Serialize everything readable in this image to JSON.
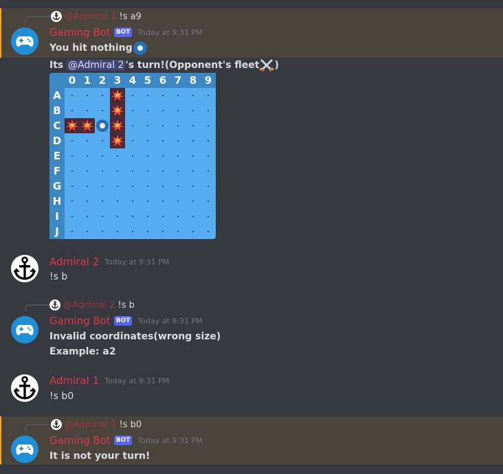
{
  "messages": [
    {
      "reply": {
        "mention": "@Admiral 1",
        "text": "!s a9"
      },
      "author": "Gaming Bot",
      "bot_tag": "BOT",
      "timestamp": "Today at 9:31 PM",
      "lines": [
        "You hit nothing"
      ],
      "follow_up": {
        "prefix": "Its ",
        "mention": "@Admiral 2",
        "suffix": "'s turn!(Opponent's fleet",
        "close": ")"
      }
    },
    {
      "author": "Admiral 2",
      "timestamp": "Today at 9:31 PM",
      "lines": [
        "!s b"
      ]
    },
    {
      "reply": {
        "mention": "@Admiral 2",
        "text": "!s b"
      },
      "author": "Gaming Bot",
      "bot_tag": "BOT",
      "timestamp": "Today at 9:31 PM",
      "lines": [
        "Invalid coordinates(wrong size)",
        "Example: a2"
      ]
    },
    {
      "author": "Admiral 1",
      "timestamp": "Today at 9:31 PM",
      "lines": [
        "!s b0"
      ]
    },
    {
      "reply": {
        "mention": "@Admiral 1",
        "text": "!s b0"
      },
      "author": "Gaming Bot",
      "bot_tag": "BOT",
      "timestamp": "Today at 9:31 PM",
      "lines": [
        "It is not your turn!"
      ]
    }
  ],
  "board": {
    "cols": [
      "0",
      "1",
      "2",
      "3",
      "4",
      "5",
      "6",
      "7",
      "8",
      "9"
    ],
    "rows": [
      "A",
      "B",
      "C",
      "D",
      "E",
      "F",
      "G",
      "H",
      "I",
      "J"
    ],
    "hits": [
      [
        0,
        3
      ],
      [
        1,
        3
      ],
      [
        2,
        0
      ],
      [
        2,
        1
      ],
      [
        2,
        3
      ],
      [
        3,
        3
      ]
    ],
    "misses": [
      [
        2,
        2
      ]
    ]
  },
  "colors": {
    "highlight": "#49443c",
    "accent": "#faa81a",
    "author": "#e0364c",
    "water": "#55acee",
    "header": "#3b88c3"
  }
}
